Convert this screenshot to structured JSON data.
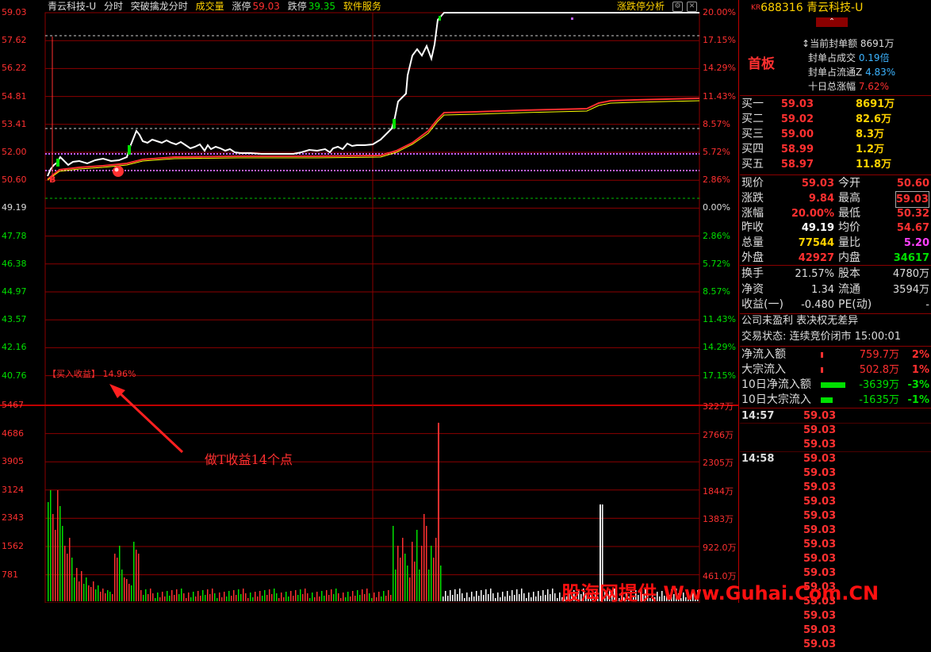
{
  "window": {
    "title": "青云科技-U"
  },
  "topbar": {
    "stock_name": "青云科技-U",
    "view_mode": "分时",
    "indicator": "突破擒龙分时",
    "volume_label": "成交量",
    "limit_up_label": "涨停",
    "limit_up_value": "59.03",
    "limit_down_label": "跌停",
    "limit_down_value": "39.35",
    "software_service": "软件服务",
    "analysis_button": "涨跌停分析",
    "icons": [
      "settings-icon",
      "close-icon",
      "expand-icon"
    ]
  },
  "price_axis": {
    "left": [
      "59.03",
      "57.62",
      "56.22",
      "54.81",
      "53.41",
      "52.00",
      "50.60",
      "49.19",
      "47.78",
      "46.38",
      "44.97",
      "43.57",
      "42.16",
      "40.76"
    ],
    "right": [
      "20.00%",
      "17.15%",
      "14.29%",
      "11.43%",
      "8.57%",
      "5.72%",
      "2.86%",
      "0.00%",
      "2.86%",
      "5.72%",
      "8.57%",
      "11.43%",
      "14.29%",
      "17.15%"
    ]
  },
  "volume_axis": {
    "left": [
      "5467",
      "4686",
      "3905",
      "3124",
      "2343",
      "1562",
      "781"
    ],
    "right": [
      "3227万",
      "2766万",
      "2305万",
      "1844万",
      "1383万",
      "922.0万",
      "461.0万"
    ]
  },
  "annotations": {
    "buy_profit_label": "【买入收益】",
    "buy_profit_value": "14.96%",
    "note": "做T收益14个点",
    "b_marker": "B"
  },
  "watermark": "股海网提供 Www.Guhai.Com.CN",
  "quote": {
    "market_badge": "KR",
    "code": "688316",
    "name": "青云科技-U",
    "tag": "首板",
    "seal_amount_label": "当前封单额",
    "seal_amount": "8691万",
    "seal_turnover_label": "封单占成交",
    "seal_turnover": "0.19倍",
    "seal_float_label": "封单占流通Z",
    "seal_float": "4.83%",
    "ten_day_label": "十日总涨幅",
    "ten_day": "7.62%",
    "bids": [
      {
        "label": "买一",
        "price": "59.03",
        "vol": "8691万"
      },
      {
        "label": "买二",
        "price": "59.02",
        "vol": "82.6万"
      },
      {
        "label": "买三",
        "price": "59.00",
        "vol": "8.3万"
      },
      {
        "label": "买四",
        "price": "58.99",
        "vol": "1.2万"
      },
      {
        "label": "买五",
        "price": "58.97",
        "vol": "11.8万"
      }
    ],
    "stats": [
      {
        "l1": "现价",
        "v1": "59.03",
        "l2": "今开",
        "v2": "50.60"
      },
      {
        "l1": "涨跌",
        "v1": "9.84",
        "l2": "最高",
        "v2": "59.03"
      },
      {
        "l1": "涨幅",
        "v1": "20.00%",
        "l2": "最低",
        "v2": "50.32"
      },
      {
        "l1": "昨收",
        "v1": "49.19",
        "l2": "均价",
        "v2": "54.67"
      },
      {
        "l1": "总量",
        "v1": "77544",
        "l2": "量比",
        "v2": "5.20"
      },
      {
        "l1": "外盘",
        "v1": "42927",
        "l2": "内盘",
        "v2": "34617"
      }
    ],
    "stats2": [
      {
        "l1": "换手",
        "v1": "21.57%",
        "l2": "股本",
        "v2": "4780万"
      },
      {
        "l1": "净资",
        "v1": "1.34",
        "l2": "流通",
        "v2": "3594万"
      },
      {
        "l1": "收益(一)",
        "v1": "-0.480",
        "l2": "PE(动)",
        "v2": "-"
      }
    ],
    "company_note": "公司未盈利 表决权无差异",
    "trade_status": "交易状态: 连续竞价闭市 15:00:01",
    "flows": [
      {
        "label": "净流入额",
        "value": "759.7万",
        "pct": "2%",
        "color": "#ff3030",
        "bar": 0.1
      },
      {
        "label": "大宗流入",
        "value": "502.8万",
        "pct": "1%",
        "color": "#ff3030",
        "bar": 0.05
      },
      {
        "label": "10日净流入额",
        "value": "-3639万",
        "pct": "-3%",
        "color": "#00e000",
        "bar": 0.9
      },
      {
        "label": "10日大宗流入",
        "value": "-1635万",
        "pct": "-1%",
        "color": "#00e000",
        "bar": 0.45
      }
    ],
    "ticks": [
      {
        "time": "14:57",
        "price": "59.03"
      },
      {
        "time": "",
        "price": "59.03"
      },
      {
        "time": "",
        "price": "59.03"
      },
      {
        "time": "14:58",
        "price": "59.03"
      },
      {
        "time": "",
        "price": "59.03"
      },
      {
        "time": "",
        "price": "59.03"
      },
      {
        "time": "",
        "price": "59.03"
      },
      {
        "time": "",
        "price": "59.03"
      },
      {
        "time": "",
        "price": "59.03"
      },
      {
        "time": "",
        "price": "59.03"
      },
      {
        "time": "",
        "price": "59.03"
      },
      {
        "time": "",
        "price": "59.03"
      },
      {
        "time": "",
        "price": "59.03"
      },
      {
        "time": "",
        "price": "59.03"
      },
      {
        "time": "",
        "price": "59.03"
      },
      {
        "time": "",
        "price": "59.03"
      },
      {
        "time": "",
        "price": "59.03"
      }
    ]
  },
  "colors": {
    "up": "#ff3030",
    "down": "#00e000",
    "price": "#ffffff",
    "avg": "#ffff00",
    "grid": "#8b0000",
    "accent": "#ffd200"
  }
}
